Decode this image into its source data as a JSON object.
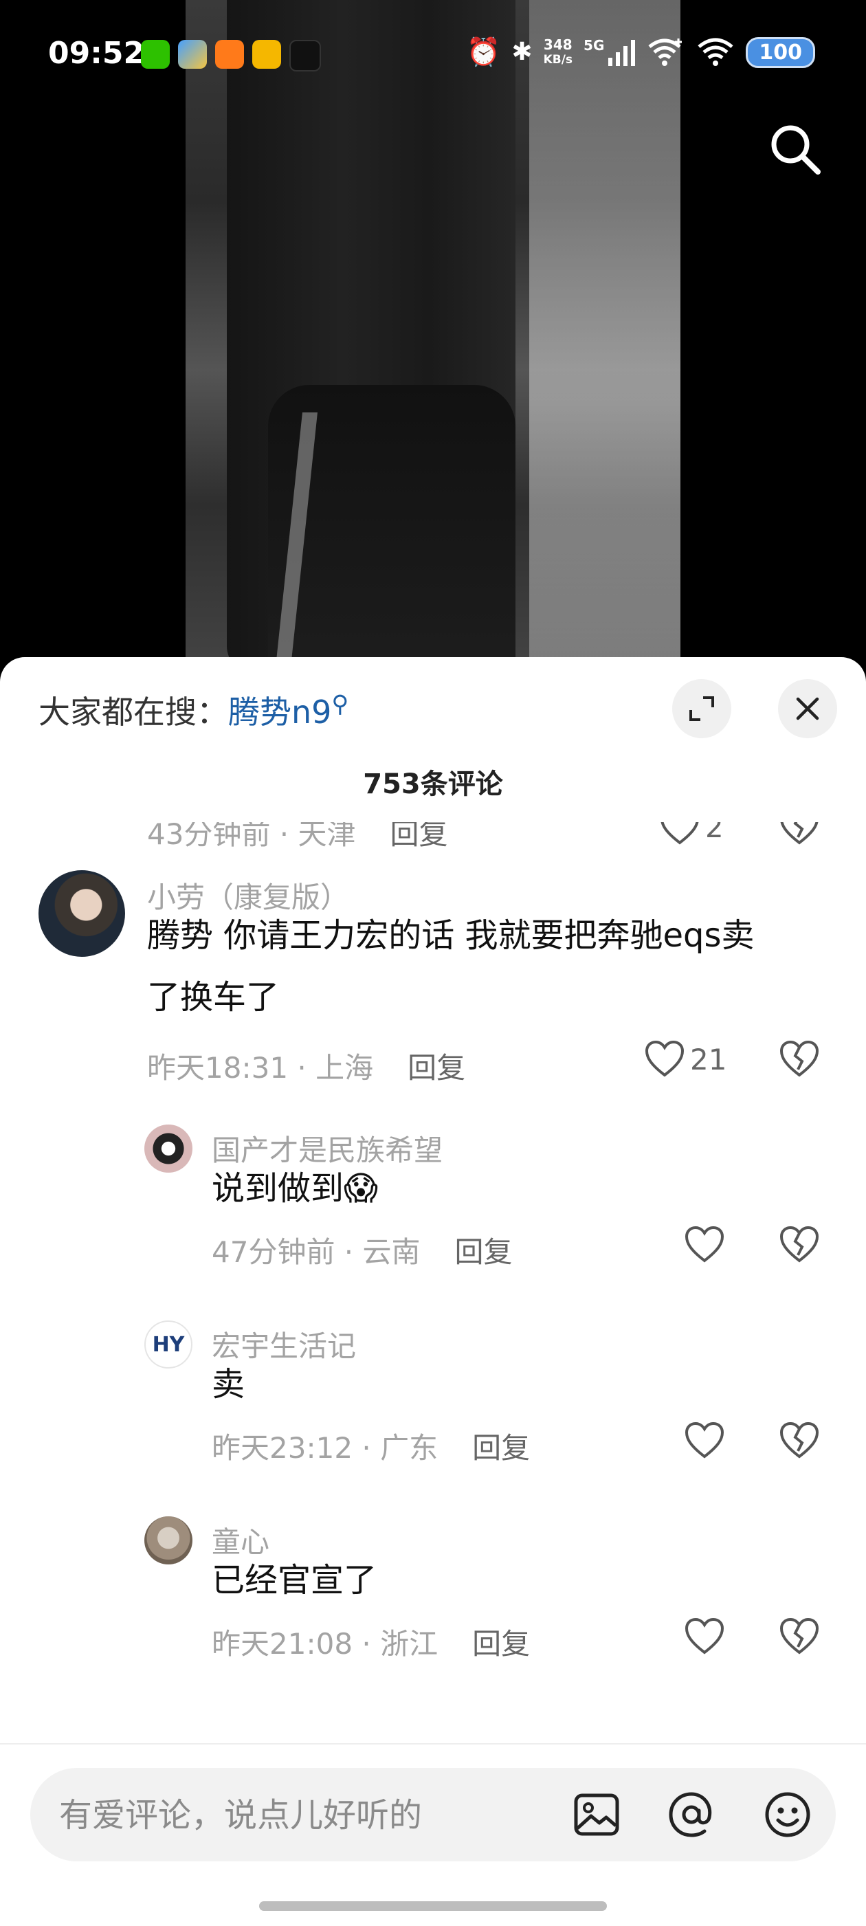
{
  "status_bar": {
    "time": "09:52",
    "net_speed_value": "348",
    "net_speed_unit": "KB/s",
    "network": "5G",
    "battery": "100"
  },
  "header": {
    "search_prefix": "大家都在搜：",
    "search_term": "腾势n9",
    "comment_count": "753条评论"
  },
  "comments": [
    {
      "partial": true,
      "meta": "43分钟前 · 天津",
      "reply_label": "回复",
      "likes": "2"
    },
    {
      "name": "小劳（康复版）",
      "content_line1": "腾势 你请王力宏的话 我就要把奔驰eqs卖",
      "content_line2": "了换车了",
      "meta": "昨天18:31 · 上海",
      "reply_label": "回复",
      "likes": "21"
    },
    {
      "name": "国产才是民族希望",
      "content": "说到做到",
      "emoji": "😱",
      "meta": "47分钟前 · 云南",
      "reply_label": "回复",
      "likes": ""
    },
    {
      "name": "宏宇生活记",
      "content": "卖",
      "meta": "昨天23:12 · 广东",
      "reply_label": "回复",
      "likes": ""
    },
    {
      "name": "童心",
      "content": "已经官宣了",
      "meta": "昨天21:08 · 浙江",
      "reply_label": "回复",
      "likes": ""
    }
  ],
  "input": {
    "placeholder": "有爱评论，说点儿好听的"
  },
  "icons": {
    "search": "search-icon",
    "expand": "expand-icon",
    "close": "close-icon",
    "like": "heart-icon",
    "dislike": "broken-heart-icon",
    "image": "image-icon",
    "mention": "at-icon",
    "emoji": "smiley-icon"
  }
}
